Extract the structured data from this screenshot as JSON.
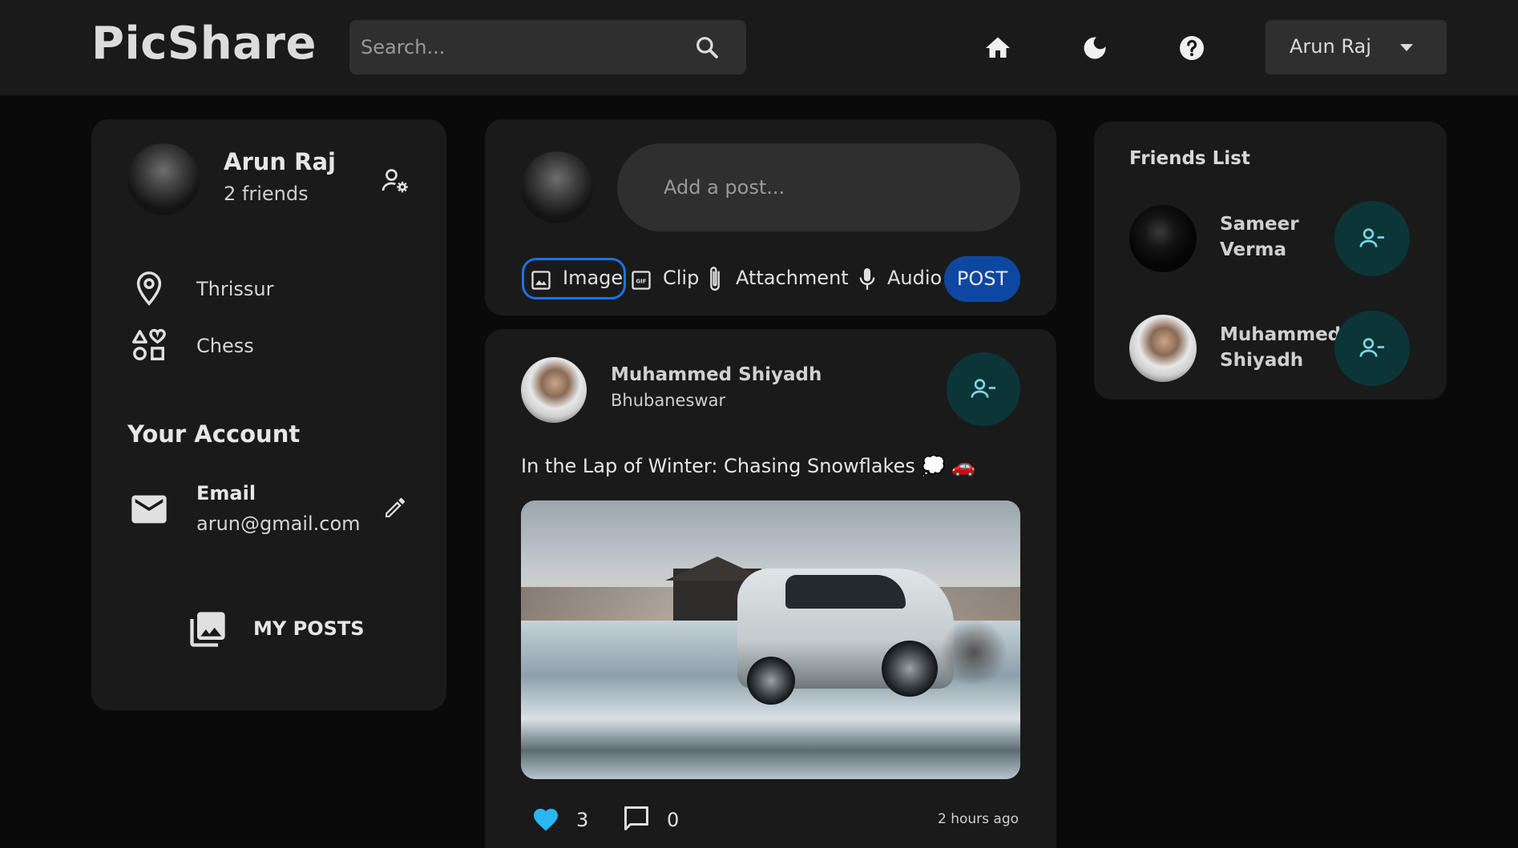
{
  "navbar": {
    "logo": "PicShare",
    "search_placeholder": "Search...",
    "user_name": "Arun Raj",
    "icons": [
      "search-icon",
      "home-icon",
      "moon-icon",
      "help-icon",
      "caret-down-icon"
    ]
  },
  "profile": {
    "name": "Arun Raj",
    "friends_count": "2 friends",
    "location": "Thrissur",
    "interest": "Chess",
    "account_heading": "Your Account",
    "email_label": "Email",
    "email_value": "arun@gmail.com",
    "my_posts_label": "MY POSTS"
  },
  "composer": {
    "placeholder": "Add a post...",
    "actions": [
      {
        "label": "Image",
        "icon": "image-icon"
      },
      {
        "label": "Clip",
        "icon": "gif-icon"
      },
      {
        "label": "Attachment",
        "icon": "paperclip-icon"
      },
      {
        "label": "Audio",
        "icon": "mic-icon"
      }
    ],
    "post_label": "POST"
  },
  "post": {
    "author": "Muhammed Shiyadh",
    "location": "Bhubaneswar",
    "caption": "In the Lap of Winter: Chasing Snowflakes 💭 🚗",
    "likes": "3",
    "comments": "0",
    "time": "2 hours ago"
  },
  "friends": {
    "heading": "Friends List",
    "items": [
      {
        "first": "Sameer",
        "last": "Verma"
      },
      {
        "first": "Muhammed",
        "last": "Shiyadh"
      }
    ]
  },
  "colors": {
    "background": "#0a0a0a",
    "card": "#1a1a1a",
    "accent_blue": "#0d47a1",
    "teal_button": "#0c3538",
    "teal_icon": "#7fd6e0",
    "like_heart": "#29b6f6"
  }
}
